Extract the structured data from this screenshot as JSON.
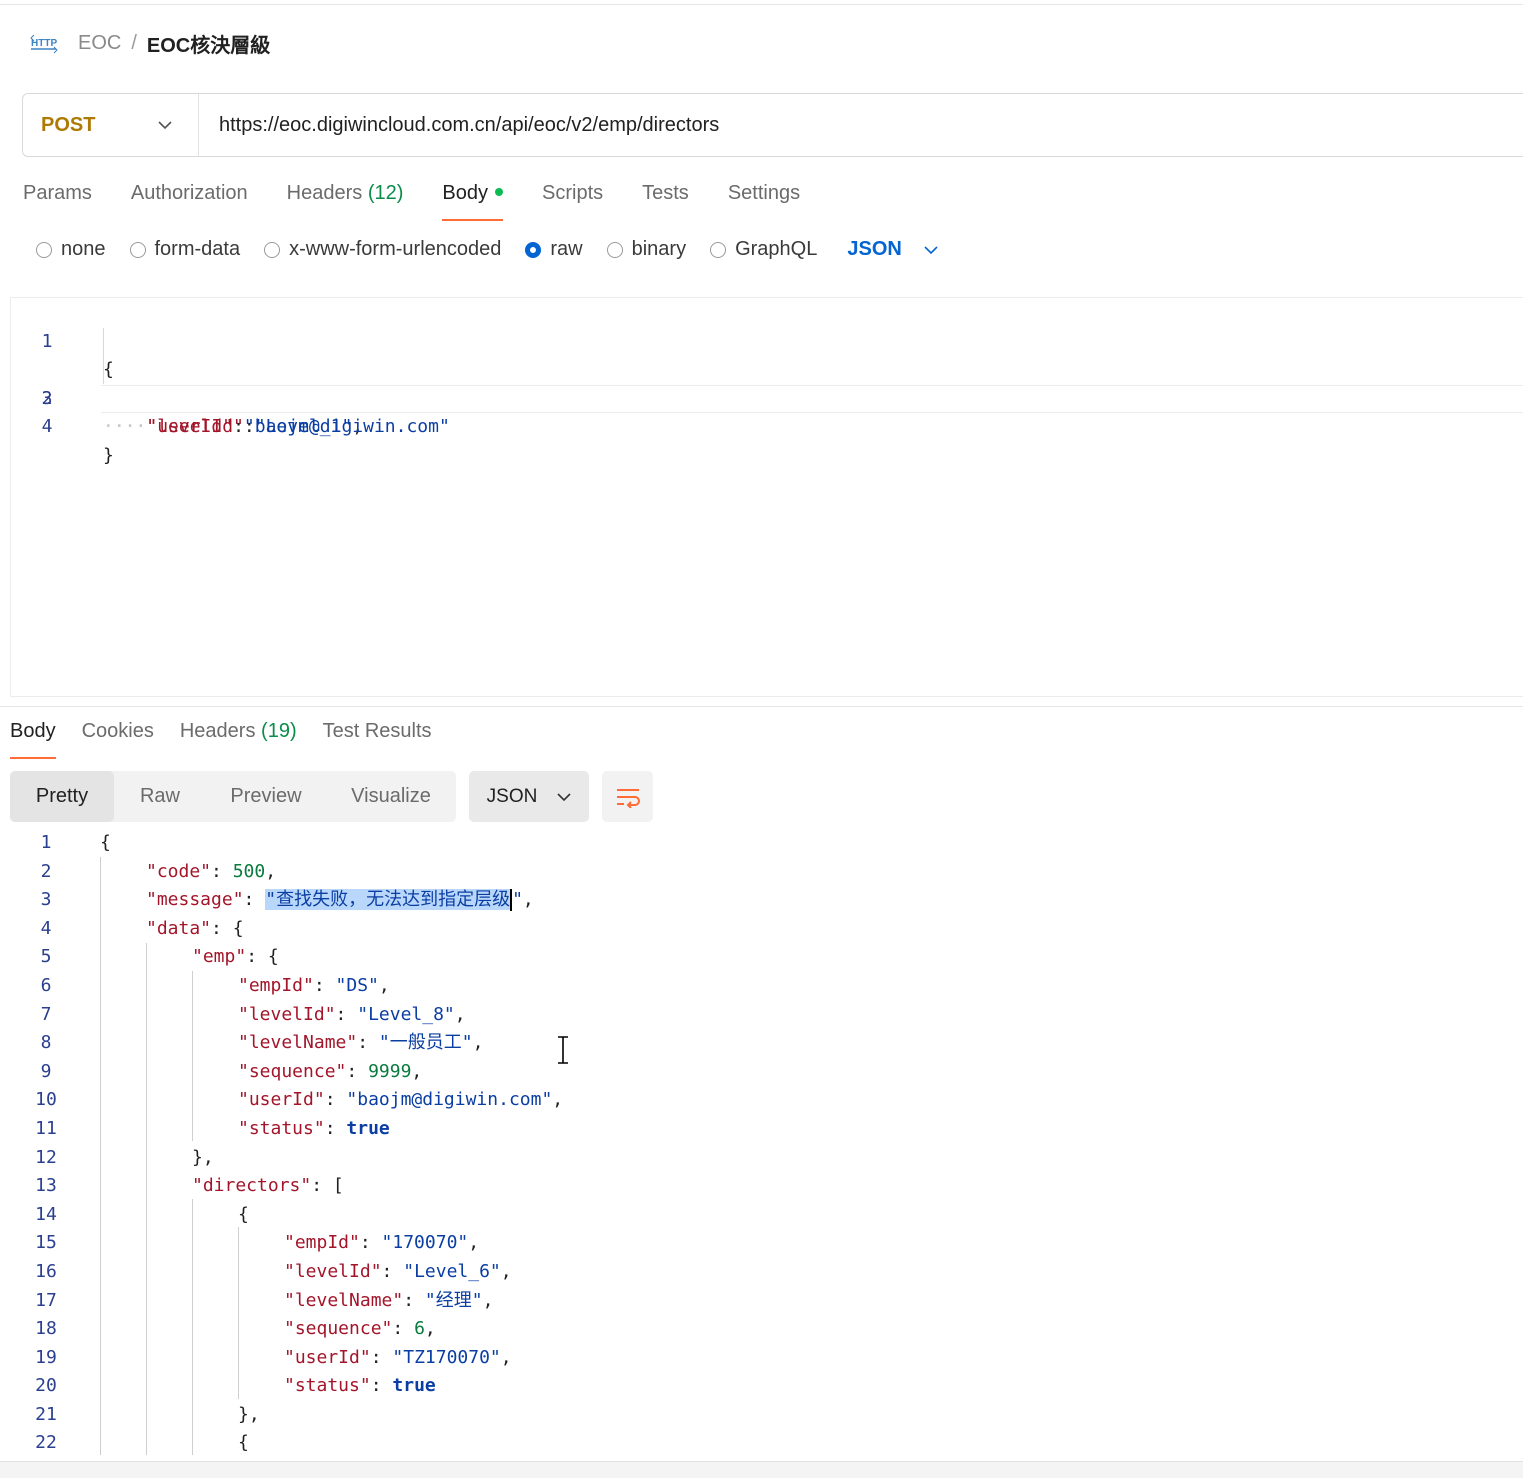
{
  "breadcrumb": {
    "icon": "http-icon",
    "collection": "EOC",
    "separator": "/",
    "request_name": "EOC核決層級"
  },
  "request": {
    "method": "POST",
    "url": "https://eoc.digiwincloud.com.cn/api/eoc/v2/emp/directors"
  },
  "request_tabs": {
    "params": "Params",
    "authorization": "Authorization",
    "headers": "Headers",
    "headers_count": "(12)",
    "body": "Body",
    "scripts": "Scripts",
    "tests": "Tests",
    "settings": "Settings",
    "active": "Body"
  },
  "body_types": {
    "none": "none",
    "form_data": "form-data",
    "urlencoded": "x-www-form-urlencoded",
    "raw": "raw",
    "binary": "binary",
    "graphql": "GraphQL",
    "selected": "raw",
    "language": "JSON"
  },
  "request_body": {
    "line_numbers": [
      "1",
      "2",
      "3",
      "4"
    ],
    "open": "{",
    "close": "}",
    "dots": "····",
    "k1": "\"levelId\"",
    "v1": "\"Level_1\"",
    "k2": "\"userId\"",
    "v2": "\"baojm@digiwin.com\"",
    "colon": ":",
    "comma": ","
  },
  "response_tabs": {
    "body": "Body",
    "cookies": "Cookies",
    "headers": "Headers",
    "headers_count": "(19)",
    "test_results": "Test Results",
    "active": "Body"
  },
  "response_view": {
    "pretty": "Pretty",
    "raw": "Raw",
    "preview": "Preview",
    "visualize": "Visualize",
    "active": "Pretty",
    "format": "JSON"
  },
  "response_body": {
    "line_numbers": [
      "1",
      "2",
      "3",
      "4",
      "5",
      "6",
      "7",
      "8",
      "9",
      "10",
      "11",
      "12",
      "13",
      "14",
      "15",
      "16",
      "17",
      "18",
      "19",
      "20",
      "21",
      "22"
    ],
    "code_key": "\"code\"",
    "code_val": "500",
    "message_key": "\"message\"",
    "message_val": "\"查找失败，无法达到指定层级",
    "data_key": "\"data\"",
    "emp_key": "\"emp\"",
    "emp": {
      "empId_key": "\"empId\"",
      "empId_val": "\"DS\"",
      "levelId_key": "\"levelId\"",
      "levelId_val": "\"Level_8\"",
      "levelName_key": "\"levelName\"",
      "levelName_val": "\"一般员工\"",
      "sequence_key": "\"sequence\"",
      "sequence_val": "9999",
      "userId_key": "\"userId\"",
      "userId_val": "\"baojm@digiwin.com\"",
      "status_key": "\"status\"",
      "status_val": "true"
    },
    "directors_key": "\"directors\"",
    "director1": {
      "empId_key": "\"empId\"",
      "empId_val": "\"170070\"",
      "levelId_key": "\"levelId\"",
      "levelId_val": "\"Level_6\"",
      "levelName_key": "\"levelName\"",
      "levelName_val": "\"经理\"",
      "sequence_key": "\"sequence\"",
      "sequence_val": "6",
      "userId_key": "\"userId\"",
      "userId_val": "\"TZ170070\"",
      "status_key": "\"status\"",
      "status_val": "true"
    }
  },
  "colors": {
    "accent": "#ff6c37",
    "method": "#ad7a03",
    "link": "#0265d2",
    "success": "#0cbb52"
  }
}
